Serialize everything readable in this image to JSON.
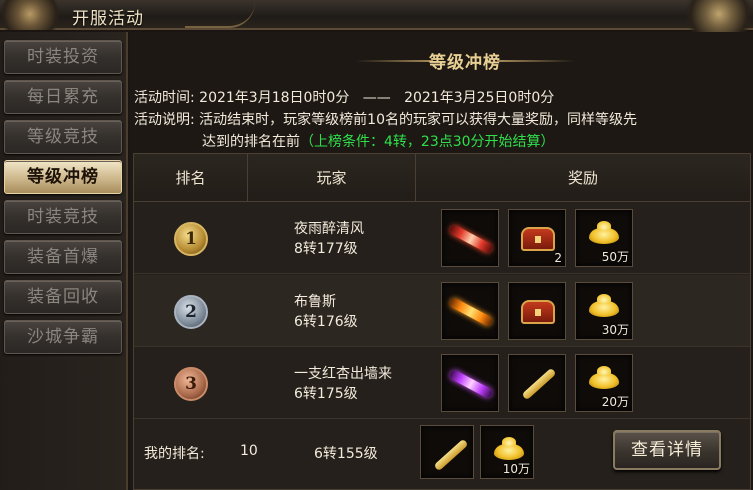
{
  "window": {
    "title": "开服活动"
  },
  "sidebar": {
    "items": [
      {
        "label": "时装投资",
        "active": false
      },
      {
        "label": "每日累充",
        "active": false
      },
      {
        "label": "等级竞技",
        "active": false
      },
      {
        "label": "等级冲榜",
        "active": true
      },
      {
        "label": "时装竞技",
        "active": false
      },
      {
        "label": "装备首爆",
        "active": false
      },
      {
        "label": "装备回收",
        "active": false
      },
      {
        "label": "沙城争霸",
        "active": false
      }
    ]
  },
  "panel": {
    "heading": "等级冲榜",
    "time_label": "活动时间:",
    "time_start": "2021年3月18日0时0分",
    "time_sep": "——",
    "time_end": "2021年3月25日0时0分",
    "desc_label": "活动说明:",
    "desc_line1": "活动结束时，玩家等级榜前10名的玩家可以获得大量奖励，同样等级先",
    "desc_line2": "达到的排名在前",
    "desc_condition": "（上榜条件：4转，23点30分开始结算）"
  },
  "table": {
    "headers": {
      "rank": "排名",
      "player": "玩家",
      "reward": "奖励"
    },
    "rows": [
      {
        "rank": "1",
        "name": "夜雨醉清风",
        "level": "8转177级",
        "rewards": [
          {
            "icon": "red-title-icon",
            "qty": ""
          },
          {
            "icon": "treasure-chest-icon",
            "qty": "2"
          },
          {
            "icon": "gold-ingot-icon",
            "qty": "50万"
          }
        ]
      },
      {
        "rank": "2",
        "name": "布鲁斯",
        "level": "6转176级",
        "rewards": [
          {
            "icon": "gold-title-icon",
            "qty": ""
          },
          {
            "icon": "treasure-chest-icon",
            "qty": ""
          },
          {
            "icon": "gold-ingot-icon",
            "qty": "30万"
          }
        ]
      },
      {
        "rank": "3",
        "name": "一支红杏出墙来",
        "level": "6转175级",
        "rewards": [
          {
            "icon": "purple-title-icon",
            "qty": ""
          },
          {
            "icon": "scroll-icon",
            "qty": ""
          },
          {
            "icon": "gold-ingot-icon",
            "qty": "20万"
          }
        ]
      }
    ]
  },
  "my_rank": {
    "label": "我的排名:",
    "rank": "10",
    "level": "6转155级",
    "rewards": [
      {
        "icon": "scroll-icon",
        "qty": ""
      },
      {
        "icon": "gold-ingot-icon",
        "qty": "10万"
      }
    ],
    "detail_button": "查看详情"
  }
}
